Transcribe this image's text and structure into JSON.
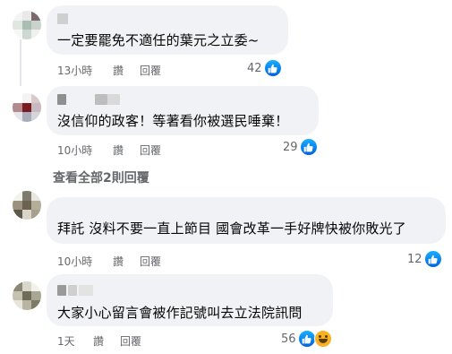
{
  "comments": [
    {
      "text": "一定要罷免不適任的葉元之立委~",
      "time": "13小時",
      "read_label": "讚",
      "reply_label": "回覆",
      "reaction_count": "42",
      "reactions": [
        "like-icon"
      ]
    },
    {
      "text": "沒信仰的政客！等著看你被選民唾棄！",
      "time": "10小時",
      "read_label": "讚",
      "reply_label": "回覆",
      "reaction_count": "29",
      "reactions": [
        "like-icon"
      ]
    },
    {
      "text": "拜託 沒料不要一直上節目 國會改革一手好牌快被你敗光了",
      "time": "10小時",
      "read_label": "讚",
      "reply_label": "回覆",
      "reaction_count": "12",
      "reactions": [
        "like-icon"
      ]
    },
    {
      "text": "大家小心留言會被作記號叫去立法院訊問",
      "time": "1天",
      "read_label": "讚",
      "reply_label": "回覆",
      "reaction_count": "56",
      "reactions": [
        "like-icon",
        "haha-icon"
      ]
    }
  ],
  "view_replies_label": "查看全部2則回覆",
  "colors": {
    "bubble": "#f0f2f5",
    "meta_text": "#65676b",
    "like_blue": "#0062df"
  }
}
